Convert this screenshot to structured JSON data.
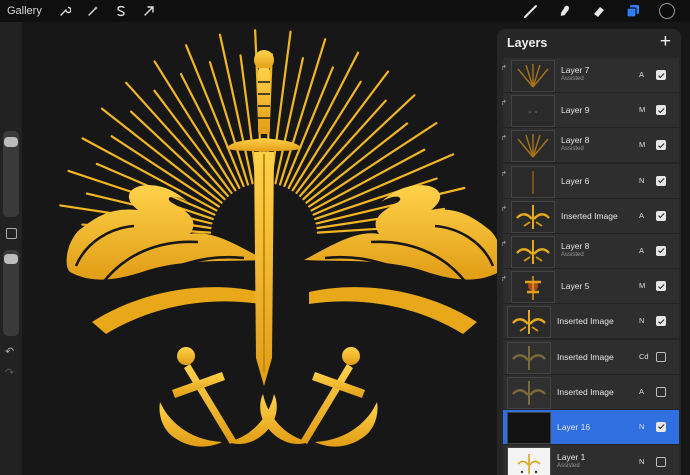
{
  "toolbar": {
    "gallery_label": "Gallery",
    "left_tools": [
      "wrench-icon",
      "magic-wand-icon",
      "selection-icon",
      "transform-arrow-icon"
    ],
    "right_tools": [
      "brush-icon",
      "smudge-icon",
      "eraser-icon",
      "layers-icon"
    ],
    "color_swatch": "#0a0a0a",
    "active_tool_color": "#2f7cf6"
  },
  "sidebar": {
    "undo_symbol": "↶",
    "redo_symbol": "↷"
  },
  "layers_panel": {
    "title": "Layers",
    "add_symbol": "+",
    "layers": [
      {
        "name": "Layer 7",
        "sub": "Assisted",
        "blend": "A",
        "visible": true,
        "thumb": "sunburst"
      },
      {
        "name": "Layer 9",
        "sub": "",
        "blend": "M",
        "visible": true,
        "thumb": "dark"
      },
      {
        "name": "Layer 8",
        "sub": "Assisted",
        "blend": "M",
        "visible": true,
        "thumb": "sunburst"
      },
      {
        "name": "Layer 6",
        "sub": "",
        "blend": "N",
        "visible": true,
        "thumb": "line"
      },
      {
        "name": "Inserted Image",
        "sub": "",
        "blend": "A",
        "visible": true,
        "thumb": "emblem"
      },
      {
        "name": "Layer 8",
        "sub": "Assisted",
        "blend": "A",
        "visible": true,
        "thumb": "emblem"
      },
      {
        "name": "Layer 5",
        "sub": "",
        "blend": "M",
        "visible": true,
        "thumb": "flower"
      },
      {
        "name": "Inserted Image",
        "sub": "",
        "blend": "N",
        "visible": true,
        "thumb": "emblem"
      },
      {
        "name": "Inserted Image",
        "sub": "",
        "blend": "Cd",
        "visible": false,
        "thumb": "emblem-faint"
      },
      {
        "name": "Inserted Image",
        "sub": "",
        "blend": "A",
        "visible": false,
        "thumb": "emblem-faint"
      },
      {
        "name": "Layer 16",
        "sub": "",
        "blend": "N",
        "visible": true,
        "thumb": "black",
        "active": true
      },
      {
        "name": "Layer 1",
        "sub": "Assisted",
        "blend": "N",
        "visible": false,
        "thumb": "white"
      }
    ]
  },
  "colors": {
    "gold": "#f2b623",
    "gold_dark": "#c98a12",
    "canvas_bg": "#171717",
    "active_layer": "#2f6fe0"
  }
}
